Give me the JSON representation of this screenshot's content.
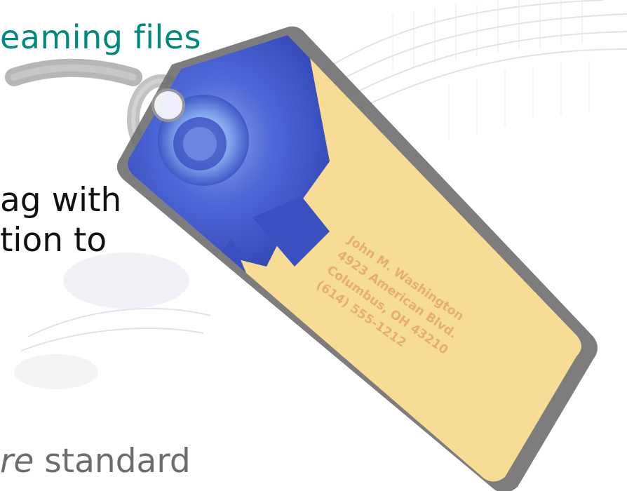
{
  "slide": {
    "title": "eaming files",
    "body_line_1": "ag with",
    "body_line_2": "tion to",
    "footer_italic": "re",
    "footer_text": " standard"
  },
  "luggage_tag": {
    "lines": [
      "John M. Washington",
      "4923 American Blvd.",
      "Columbus, OH 43210",
      "(614) 555-1212"
    ]
  },
  "colors": {
    "title": "#008a7a",
    "body": "#111111",
    "footer": "#6d6d6d",
    "tag_frame": "#6b6b6b",
    "tag_card": "#f7dc95",
    "tag_flower": "#3f58c8"
  }
}
